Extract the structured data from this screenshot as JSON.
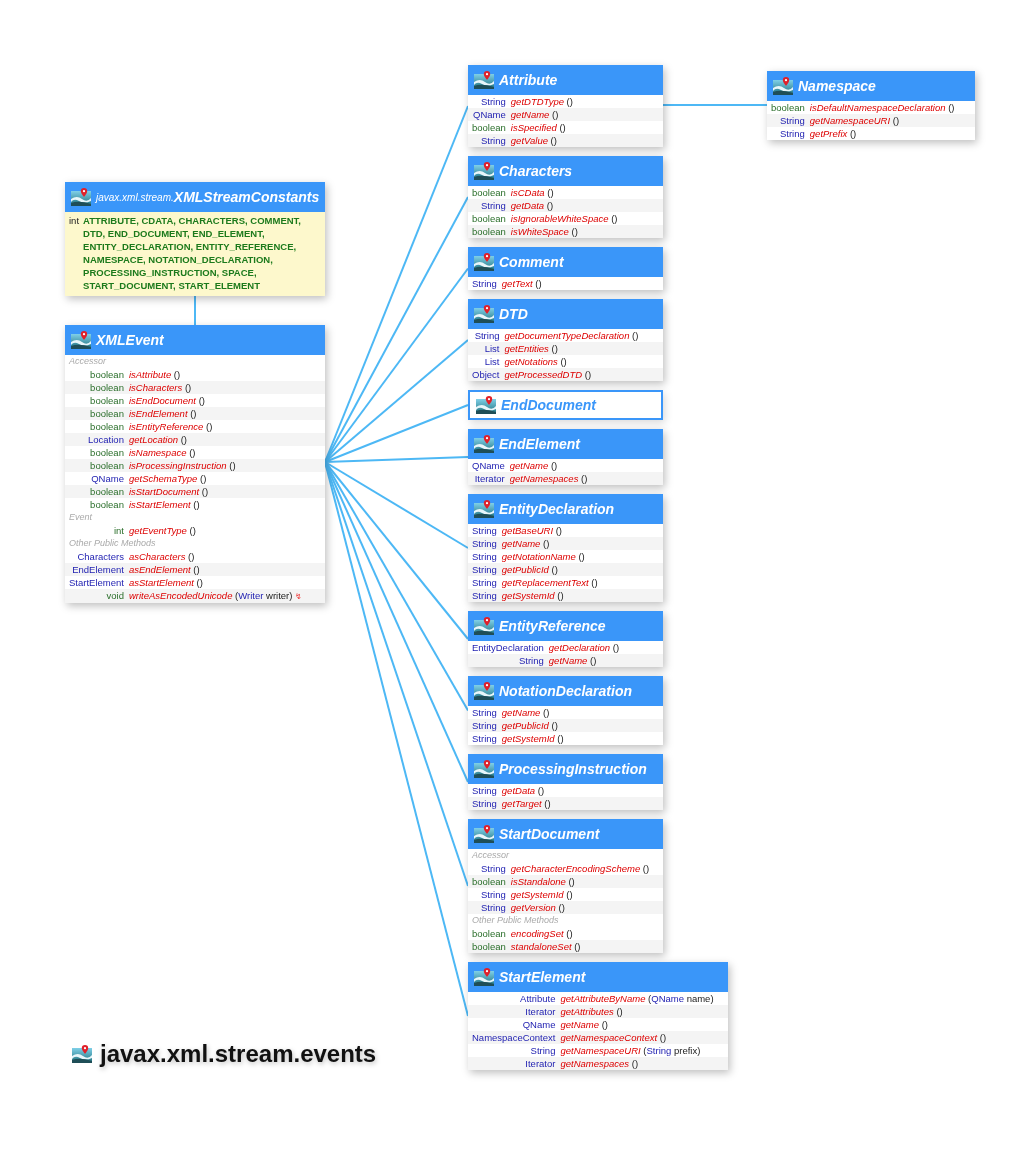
{
  "title": "javax.xml.stream.events",
  "classes": [
    {
      "kind": "constants",
      "package": "javax.xml.stream.",
      "name": "XMLStreamConstants",
      "constants_type": "int",
      "constants": "ATTRIBUTE, CDATA, CHARACTERS, COMMENT, DTD, END_DOCUMENT, END_ELEMENT, ENTITY_DECLARATION, ENTITY_REFERENCE, NAMESPACE, NOTATION_DECLARATION, PROCESSING_INSTRUCTION, SPACE, START_DOCUMENT, START_ELEMENT"
    },
    {
      "kind": "interface",
      "name": "XMLEvent",
      "sections": [
        {
          "heading": "Accessor",
          "members": [
            {
              "type": "boolean",
              "kind": "primitive",
              "name": "isAttribute",
              "params": "()"
            },
            {
              "type": "boolean",
              "kind": "primitive",
              "name": "isCharacters",
              "params": "()"
            },
            {
              "type": "boolean",
              "kind": "primitive",
              "name": "isEndDocument",
              "params": "()"
            },
            {
              "type": "boolean",
              "kind": "primitive",
              "name": "isEndElement",
              "params": "()"
            },
            {
              "type": "boolean",
              "kind": "primitive",
              "name": "isEntityReference",
              "params": "()"
            },
            {
              "type": "Location",
              "kind": "reference",
              "name": "getLocation",
              "params": "()"
            },
            {
              "type": "boolean",
              "kind": "primitive",
              "name": "isNamespace",
              "params": "()"
            },
            {
              "type": "boolean",
              "kind": "primitive",
              "name": "isProcessingInstruction",
              "params": "()"
            },
            {
              "type": "QName",
              "kind": "reference",
              "name": "getSchemaType",
              "params": "()"
            },
            {
              "type": "boolean",
              "kind": "primitive",
              "name": "isStartDocument",
              "params": "()"
            },
            {
              "type": "boolean",
              "kind": "primitive",
              "name": "isStartElement",
              "params": "()"
            }
          ]
        },
        {
          "heading": "Event",
          "members": [
            {
              "type": "int",
              "kind": "primitive",
              "name": "getEventType",
              "params": "()"
            }
          ]
        },
        {
          "heading": "Other Public Methods",
          "members": [
            {
              "type": "Characters",
              "kind": "reference",
              "name": "asCharacters",
              "params": "()"
            },
            {
              "type": "EndElement",
              "kind": "reference",
              "name": "asEndElement",
              "params": "()"
            },
            {
              "type": "StartElement",
              "kind": "reference",
              "name": "asStartElement",
              "params": "()"
            },
            {
              "type": "void",
              "kind": "primitive",
              "name": "writeAsEncodedUnicode",
              "params": [
                {
                  "kind": "punct",
                  "text": "("
                },
                {
                  "kind": "type",
                  "text": "Writer"
                },
                {
                  "kind": "plain",
                  "text": " writer)"
                }
              ],
              "marker": "↯"
            }
          ]
        }
      ]
    },
    {
      "kind": "interface",
      "name": "Attribute",
      "sections": [
        {
          "members": [
            {
              "type": "String",
              "kind": "reference",
              "name": "getDTDType",
              "params": "()"
            },
            {
              "type": "QName",
              "kind": "reference",
              "name": "getName",
              "params": "()"
            },
            {
              "type": "boolean",
              "kind": "primitive",
              "name": "isSpecified",
              "params": "()"
            },
            {
              "type": "String",
              "kind": "reference",
              "name": "getValue",
              "params": "()"
            }
          ]
        }
      ]
    },
    {
      "kind": "interface",
      "name": "Namespace",
      "sections": [
        {
          "members": [
            {
              "type": "boolean",
              "kind": "primitive",
              "name": "isDefaultNamespaceDeclaration",
              "params": "()"
            },
            {
              "type": "String",
              "kind": "reference",
              "name": "getNamespaceURI",
              "params": "()"
            },
            {
              "type": "String",
              "kind": "reference",
              "name": "getPrefix",
              "params": "()"
            }
          ]
        }
      ]
    },
    {
      "kind": "interface",
      "name": "Characters",
      "sections": [
        {
          "members": [
            {
              "type": "boolean",
              "kind": "primitive",
              "name": "isCData",
              "params": "()"
            },
            {
              "type": "String",
              "kind": "reference",
              "name": "getData",
              "params": "()"
            },
            {
              "type": "boolean",
              "kind": "primitive",
              "name": "isIgnorableWhiteSpace",
              "params": "()"
            },
            {
              "type": "boolean",
              "kind": "primitive",
              "name": "isWhiteSpace",
              "params": "()"
            }
          ]
        }
      ]
    },
    {
      "kind": "interface",
      "name": "Comment",
      "sections": [
        {
          "members": [
            {
              "type": "String",
              "kind": "reference",
              "name": "getText",
              "params": "()"
            }
          ]
        }
      ]
    },
    {
      "kind": "interface",
      "name": "DTD",
      "sections": [
        {
          "members": [
            {
              "type": "String",
              "kind": "reference",
              "name": "getDocumentTypeDeclaration",
              "params": "()"
            },
            {
              "type": "List",
              "kind": "reference",
              "name": "getEntities",
              "params": "()"
            },
            {
              "type": "List",
              "kind": "reference",
              "name": "getNotations",
              "params": "()"
            },
            {
              "type": "Object",
              "kind": "reference",
              "name": "getProcessedDTD",
              "params": "()"
            }
          ]
        }
      ]
    },
    {
      "kind": "interface",
      "name": "EndDocument"
    },
    {
      "kind": "interface",
      "name": "EndElement",
      "sections": [
        {
          "members": [
            {
              "type": "QName",
              "kind": "reference",
              "name": "getName",
              "params": "()"
            },
            {
              "type": "Iterator",
              "kind": "reference",
              "name": "getNamespaces",
              "params": "()"
            }
          ]
        }
      ]
    },
    {
      "kind": "interface",
      "name": "EntityDeclaration",
      "sections": [
        {
          "members": [
            {
              "type": "String",
              "kind": "reference",
              "name": "getBaseURI",
              "params": "()"
            },
            {
              "type": "String",
              "kind": "reference",
              "name": "getName",
              "params": "()"
            },
            {
              "type": "String",
              "kind": "reference",
              "name": "getNotationName",
              "params": "()"
            },
            {
              "type": "String",
              "kind": "reference",
              "name": "getPublicId",
              "params": "()"
            },
            {
              "type": "String",
              "kind": "reference",
              "name": "getReplacementText",
              "params": "()"
            },
            {
              "type": "String",
              "kind": "reference",
              "name": "getSystemId",
              "params": "()"
            }
          ]
        }
      ]
    },
    {
      "kind": "interface",
      "name": "EntityReference",
      "sections": [
        {
          "members": [
            {
              "type": "EntityDeclaration",
              "kind": "reference",
              "name": "getDeclaration",
              "params": "()"
            },
            {
              "type": "String",
              "kind": "reference",
              "name": "getName",
              "params": "()"
            }
          ]
        }
      ]
    },
    {
      "kind": "interface",
      "name": "NotationDeclaration",
      "sections": [
        {
          "members": [
            {
              "type": "String",
              "kind": "reference",
              "name": "getName",
              "params": "()"
            },
            {
              "type": "String",
              "kind": "reference",
              "name": "getPublicId",
              "params": "()"
            },
            {
              "type": "String",
              "kind": "reference",
              "name": "getSystemId",
              "params": "()"
            }
          ]
        }
      ]
    },
    {
      "kind": "interface",
      "name": "ProcessingInstruction",
      "sections": [
        {
          "members": [
            {
              "type": "String",
              "kind": "reference",
              "name": "getData",
              "params": "()"
            },
            {
              "type": "String",
              "kind": "reference",
              "name": "getTarget",
              "params": "()"
            }
          ]
        }
      ]
    },
    {
      "kind": "interface",
      "name": "StartDocument",
      "sections": [
        {
          "heading": "Accessor",
          "members": [
            {
              "type": "String",
              "kind": "reference",
              "name": "getCharacterEncodingScheme",
              "params": "()"
            },
            {
              "type": "boolean",
              "kind": "primitive",
              "name": "isStandalone",
              "params": "()"
            },
            {
              "type": "String",
              "kind": "reference",
              "name": "getSystemId",
              "params": "()"
            },
            {
              "type": "String",
              "kind": "reference",
              "name": "getVersion",
              "params": "()"
            }
          ]
        },
        {
          "heading": "Other Public Methods",
          "members": [
            {
              "type": "boolean",
              "kind": "primitive",
              "name": "encodingSet",
              "params": "()"
            },
            {
              "type": "boolean",
              "kind": "primitive",
              "name": "standaloneSet",
              "params": "()"
            }
          ]
        }
      ]
    },
    {
      "kind": "interface",
      "name": "StartElement",
      "sections": [
        {
          "members": [
            {
              "type": "Attribute",
              "kind": "reference",
              "name": "getAttributeByName",
              "params": [
                {
                  "kind": "punct",
                  "text": "("
                },
                {
                  "kind": "type",
                  "text": "QName"
                },
                {
                  "kind": "plain",
                  "text": " name)"
                }
              ]
            },
            {
              "type": "Iterator",
              "kind": "reference",
              "name": "getAttributes",
              "params": "()"
            },
            {
              "type": "QName",
              "kind": "reference",
              "name": "getName",
              "params": "()"
            },
            {
              "type": "NamespaceContext",
              "kind": "reference",
              "name": "getNamespaceContext",
              "params": "()"
            },
            {
              "type": "String",
              "kind": "reference",
              "name": "getNamespaceURI",
              "params": [
                {
                  "kind": "punct",
                  "text": "("
                },
                {
                  "kind": "type",
                  "text": "String"
                },
                {
                  "kind": "plain",
                  "text": " prefix)"
                }
              ]
            },
            {
              "type": "Iterator",
              "kind": "reference",
              "name": "getNamespaces",
              "params": "()"
            }
          ]
        }
      ]
    }
  ]
}
